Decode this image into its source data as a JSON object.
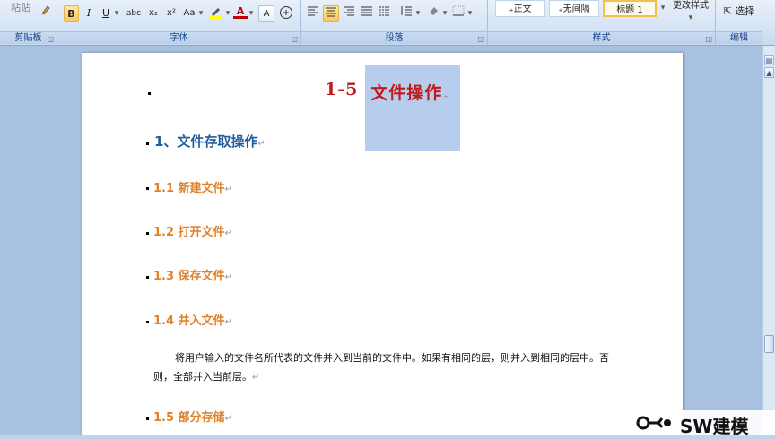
{
  "ribbon": {
    "clipboard": {
      "paste": "粘贴",
      "label": "剪贴板"
    },
    "font": {
      "bold": "B",
      "italic": "I",
      "underline": "U",
      "strike": "abc",
      "sub": "x₂",
      "sup": "x²",
      "change_case": "Aa",
      "font_color": "A",
      "char_border": "A",
      "label": "字体"
    },
    "paragraph": {
      "label": "段落"
    },
    "styles": {
      "normal": "₊正文",
      "no_spacing": "₊无间隔",
      "heading1": "标题 1",
      "change_styles": "更改样式",
      "label": "样式"
    },
    "editing": {
      "select": "选择",
      "label": "编辑"
    }
  },
  "document": {
    "title_prefix": "1-5",
    "title_selected": "文件操作",
    "heading1": "1、文件存取操作",
    "h2": [
      "1.1 新建文件",
      "1.2 打开文件",
      "1.3 保存文件",
      "1.4 并入文件",
      "1.5 部分存储"
    ],
    "paragraph": "将用户输入的文件名所代表的文件并入到当前的文件中。如果有相同的层，则并入到相同的层中。否则，全部并入当前层。"
  },
  "watermark": {
    "text": "SW建模"
  },
  "colors": {
    "title": "#c01a1a",
    "heading1": "#1f5f9e",
    "heading2": "#e0812c",
    "selection": "#b6cdee"
  }
}
